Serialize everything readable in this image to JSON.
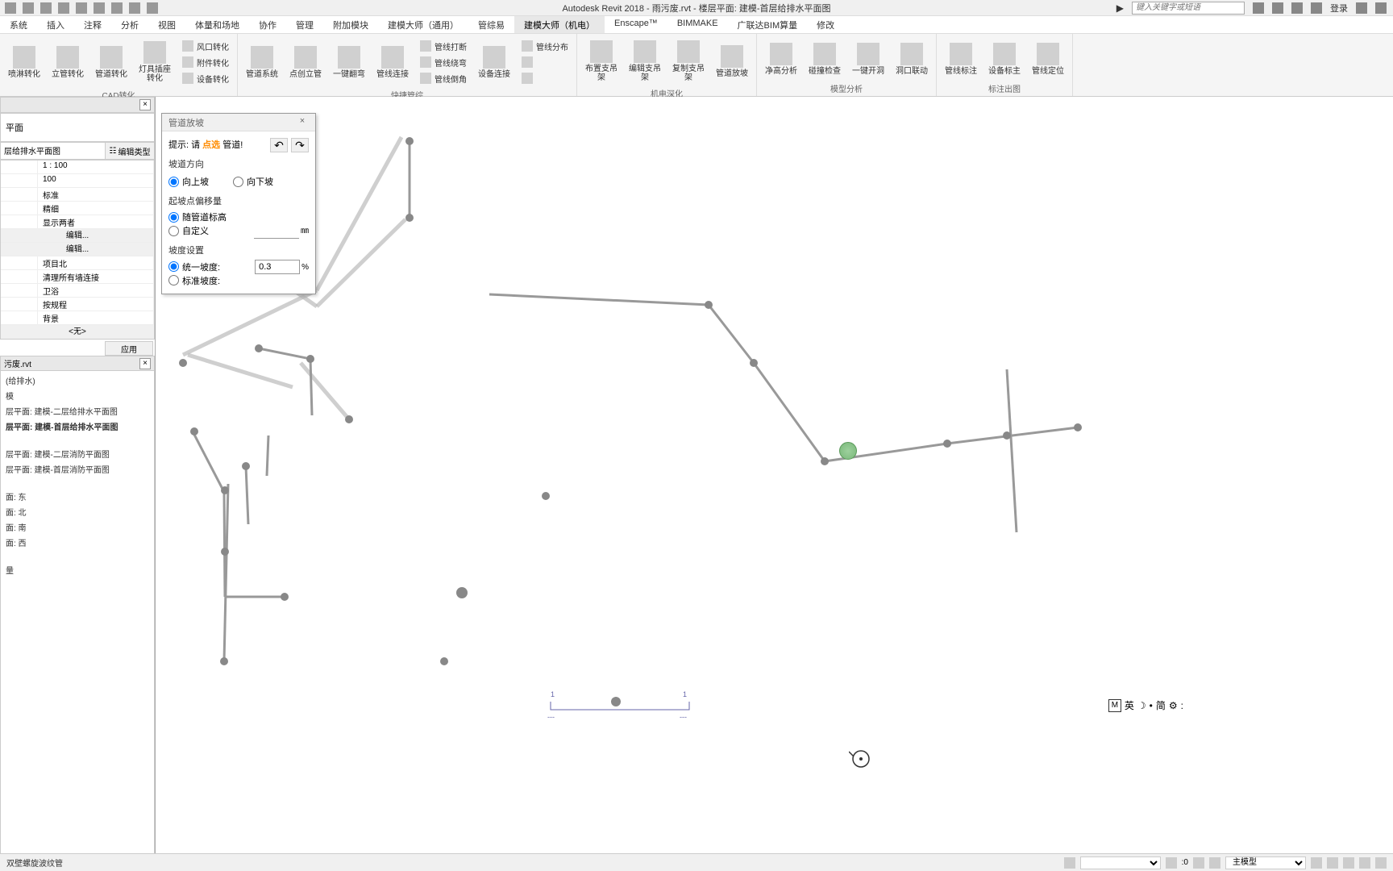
{
  "app": {
    "title": "Autodesk Revit 2018 -   雨污废.rvt - 楼层平面: 建模-首层给排水平面图",
    "search_placeholder": "键入关键字或短语",
    "login": "登录"
  },
  "tabs": [
    "系统",
    "插入",
    "注释",
    "分析",
    "视图",
    "体量和场地",
    "协作",
    "管理",
    "附加模块",
    "建模大师（通用）",
    "管综易",
    "建模大师（机电）",
    "Enscape™",
    "BIMMAKE",
    "广联达BIM算量",
    "修改"
  ],
  "active_tab": "建模大师（机电）",
  "ribbon": {
    "groups": [
      {
        "label": "CAD转化",
        "items": [
          {
            "type": "large",
            "label": "喷淋转化"
          },
          {
            "type": "large",
            "label": "立管转化"
          },
          {
            "type": "large",
            "label": "管道转化"
          },
          {
            "type": "large",
            "label": "灯具插座转化"
          },
          {
            "type": "col",
            "items": [
              "风口转化",
              "附件转化",
              "设备转化"
            ]
          }
        ]
      },
      {
        "label": "快捷管综",
        "items": [
          {
            "type": "large",
            "label": "管道系统"
          },
          {
            "type": "large",
            "label": "点创立管"
          },
          {
            "type": "large",
            "label": "一键翻弯"
          },
          {
            "type": "large",
            "label": "管线连接"
          },
          {
            "type": "col",
            "items": [
              "管线打断",
              "管线绕弯",
              "管线倒角"
            ]
          },
          {
            "type": "large",
            "label": "设备连接"
          },
          {
            "type": "col",
            "items": [
              "管线分布",
              "",
              ""
            ]
          }
        ]
      },
      {
        "label": "机电深化",
        "items": [
          {
            "type": "large",
            "label": "布置支吊架"
          },
          {
            "type": "large",
            "label": "编辑支吊架"
          },
          {
            "type": "large",
            "label": "复制支吊架"
          },
          {
            "type": "large",
            "label": "管道放坡"
          }
        ]
      },
      {
        "label": "模型分析",
        "items": [
          {
            "type": "large",
            "label": "净高分析"
          },
          {
            "type": "large",
            "label": "碰撞检查"
          },
          {
            "type": "large",
            "label": "一键开洞"
          },
          {
            "type": "large",
            "label": "洞口联动"
          }
        ]
      },
      {
        "label": "标注出图",
        "items": [
          {
            "type": "large",
            "label": "管线标注"
          },
          {
            "type": "large",
            "label": "设备标主"
          },
          {
            "type": "large",
            "label": "管线定位"
          }
        ]
      }
    ]
  },
  "properties": {
    "header": "",
    "type_label": "平面",
    "type_dropdown": "层给排水平面图",
    "edit_type_btn": "编辑类型",
    "rows": [
      {
        "l": "",
        "r": "1 : 100"
      },
      {
        "l": "",
        "r": "100"
      },
      {
        "l": "",
        "r": "标准"
      },
      {
        "l": "",
        "r": "精细"
      },
      {
        "l": "",
        "r": "显示两者"
      }
    ],
    "edit_btn": "编辑...",
    "rows2": [
      {
        "l": "",
        "r": "项目北"
      },
      {
        "l": "",
        "r": "清理所有墙连接"
      },
      {
        "l": "",
        "r": "卫浴"
      },
      {
        "l": "",
        "r": "按规程"
      },
      {
        "l": "",
        "r": "背景"
      }
    ],
    "none": "<无>",
    "apply": "应用"
  },
  "browser": {
    "header": "污废.rvt",
    "items": [
      {
        "t": "(给排水)",
        "bold": false
      },
      {
        "t": "模",
        "bold": false
      },
      {
        "t": "层平面: 建模-二层给排水平面图",
        "bold": false
      },
      {
        "t": "层平面: 建模-首层给排水平面图",
        "bold": true
      },
      {
        "t": "",
        "bold": false
      },
      {
        "t": "层平面: 建模-二层消防平面图",
        "bold": false
      },
      {
        "t": "层平面: 建模-首层消防平面图",
        "bold": false
      },
      {
        "t": "",
        "bold": false
      },
      {
        "t": "面: 东",
        "bold": false
      },
      {
        "t": "面: 北",
        "bold": false
      },
      {
        "t": "面: 南",
        "bold": false
      },
      {
        "t": "面: 西",
        "bold": false
      },
      {
        "t": "",
        "bold": false
      },
      {
        "t": "量",
        "bold": false
      }
    ]
  },
  "dialog": {
    "title": "管道放坡",
    "hint_pre": "提示: 请 ",
    "hint_mid": "点选",
    "hint_post": " 管道!",
    "sec1": "坡道方向",
    "r1a": "向上坡",
    "r1b": "向下坡",
    "sec2": "起坡点偏移量",
    "r2a": "随管道标高",
    "r2b": "自定义",
    "unit2": "㎜",
    "sec3": "坡度设置",
    "r3a": "统一坡度:",
    "r3b": "标准坡度:",
    "val3": "0.3",
    "unit3": "%"
  },
  "view_controls": {
    "l1": "1",
    "r1": "1"
  },
  "ime": {
    "m": "M",
    "lang": "英",
    "simp": "简"
  },
  "status": {
    "left": "双壁螺旋波纹管",
    "zoom": ":0",
    "model": "主模型"
  }
}
